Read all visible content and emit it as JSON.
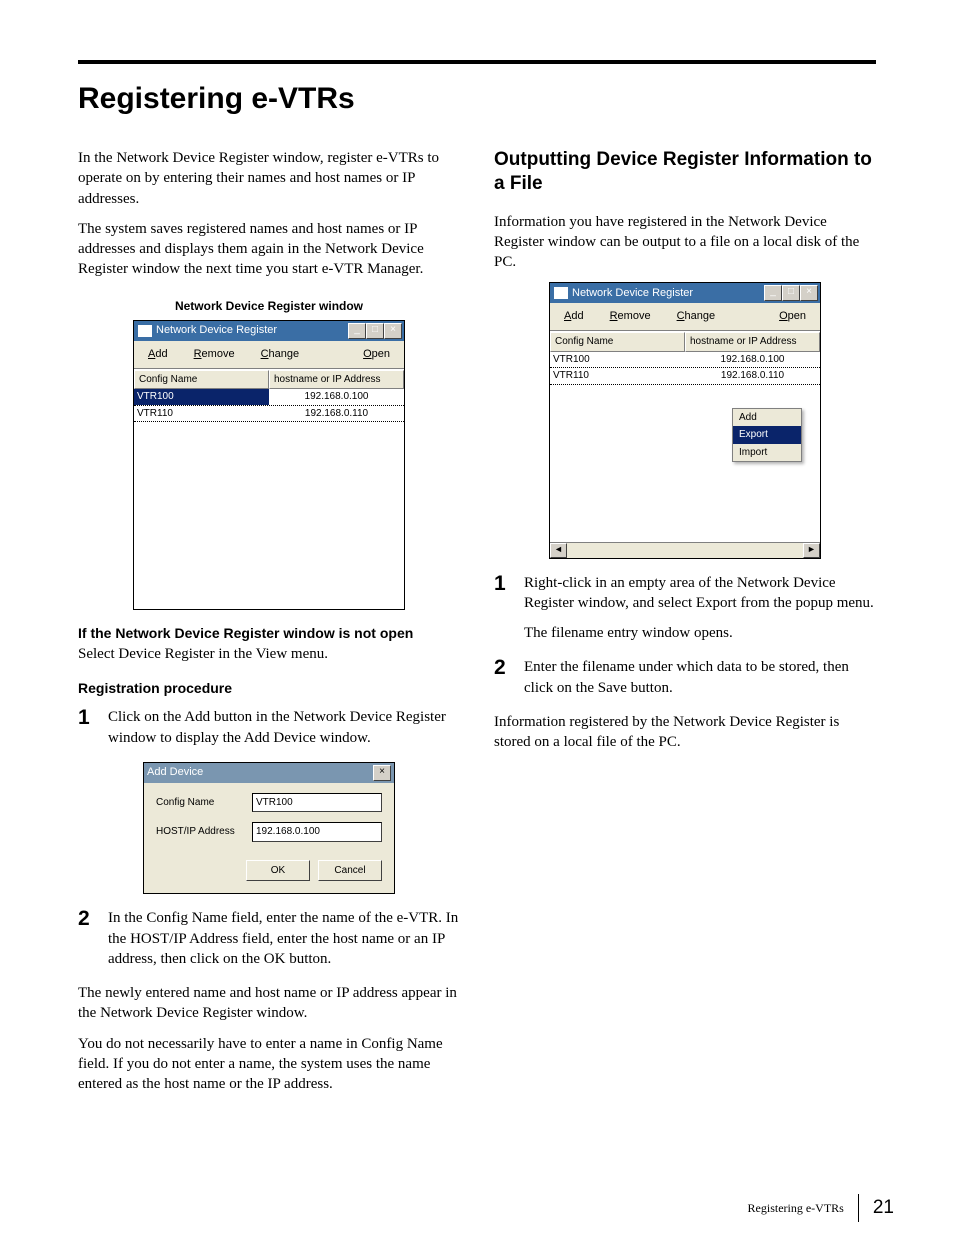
{
  "page_title": "Registering e-VTRs",
  "left": {
    "intro1": "In the Network Device Register window, register e-VTRs to operate on by entering their names and host names or IP addresses.",
    "intro2": "The system saves registered names and host names or IP addresses and displays them again in the Network Device Register window the next time you start e-VTR Manager.",
    "caption": "Network Device Register window",
    "window1": {
      "title": "Network Device Register",
      "buttons": {
        "add_pre": "A",
        "add_rest": "dd",
        "remove_pre": "R",
        "remove_rest": "emove",
        "change_pre": "C",
        "change_rest": "hange",
        "open_pre": "O",
        "open_rest": "pen"
      },
      "cols": {
        "c1": "Config Name",
        "c2": "hostname or IP Address"
      },
      "rows": [
        {
          "name": "VTR100",
          "addr": "192.168.0.100",
          "selected": true
        },
        {
          "name": "VTR110",
          "addr": "192.168.0.110",
          "selected": false
        }
      ]
    },
    "not_open_head": "If the Network Device Register window is not open",
    "not_open_body": "Select Device Register in the View menu.",
    "reg_proc_head": "Registration procedure",
    "step1": "Click on the Add button in the Network Device Register window to display the Add Device window.",
    "add_dlg": {
      "title": "Add Device",
      "label1": "Config Name",
      "value1": "VTR100",
      "label2": "HOST/IP Address",
      "value2": "192.168.0.100",
      "ok": "OK",
      "cancel": "Cancel"
    },
    "step2": "In the Config Name field, enter the name of the e-VTR. In the HOST/IP Address field, enter the host name or an IP address, then click on the OK button.",
    "after1": "The newly entered name and host name or IP address appear in the Network Device Register window.",
    "after2": "You do not necessarily have to enter a name in Config Name field. If you do not enter a name, the system uses the name entered as the host name or the IP address."
  },
  "right": {
    "section_title": "Outputting Device Register Information to a File",
    "intro": "Information you have registered in the Network Device Register window can be output to a file on a local disk of the PC.",
    "window2": {
      "title": "Network Device Register",
      "buttons": {
        "add_pre": "A",
        "add_rest": "dd",
        "remove_pre": "R",
        "remove_rest": "emove",
        "change_pre": "C",
        "change_rest": "hange",
        "open_pre": "O",
        "open_rest": "pen"
      },
      "cols": {
        "c1": "Config Name",
        "c2": "hostname or IP Address"
      },
      "rows": [
        {
          "name": "VTR100",
          "addr": "192.168.0.100"
        },
        {
          "name": "VTR110",
          "addr": "192.168.0.110"
        }
      ],
      "context_menu": {
        "add": "Add",
        "export": "Export",
        "import": "Import"
      }
    },
    "step1a": "Right-click in an empty area of the Network Device Register window, and select Export from the popup menu.",
    "step1b": "The filename entry window opens.",
    "step2": "Enter the filename under which data to be stored, then click on the Save button.",
    "after": "Information registered by the Network Device Register is stored on a local file of the PC."
  },
  "footer": {
    "label": "Registering e-VTRs",
    "page": "21"
  }
}
